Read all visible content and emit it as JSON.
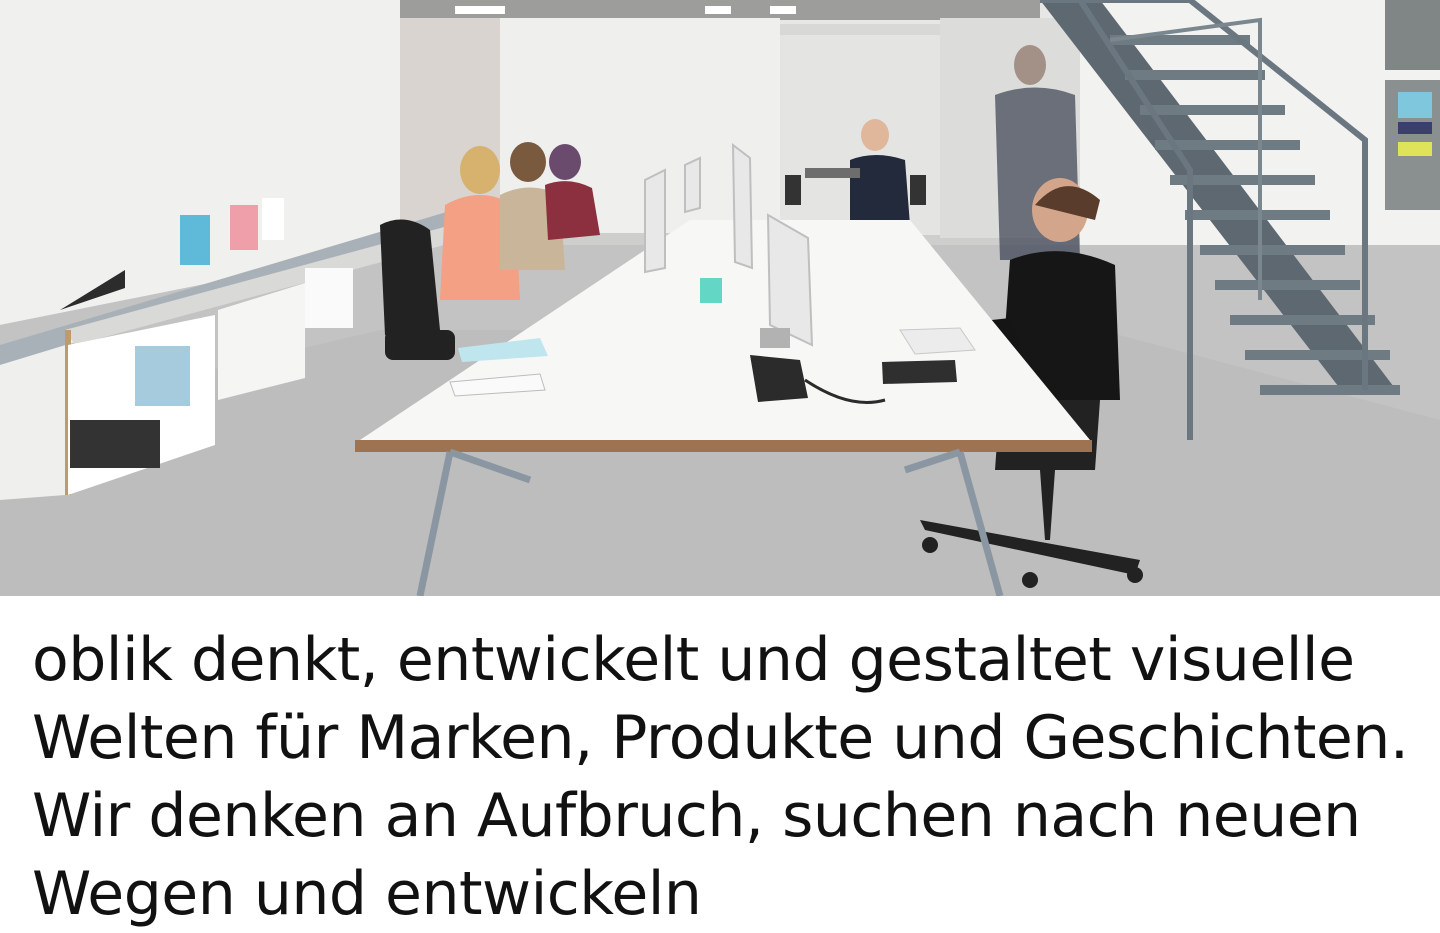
{
  "hero": {
    "scene": "office-workspace-photo"
  },
  "intro": {
    "text": "oblik denkt, entwickelt und gestaltet visuelle Welten für Marken, Produkte und Geschichten. Wir denken an Aufbruch, suchen nach neuen Wegen und entwickeln"
  }
}
